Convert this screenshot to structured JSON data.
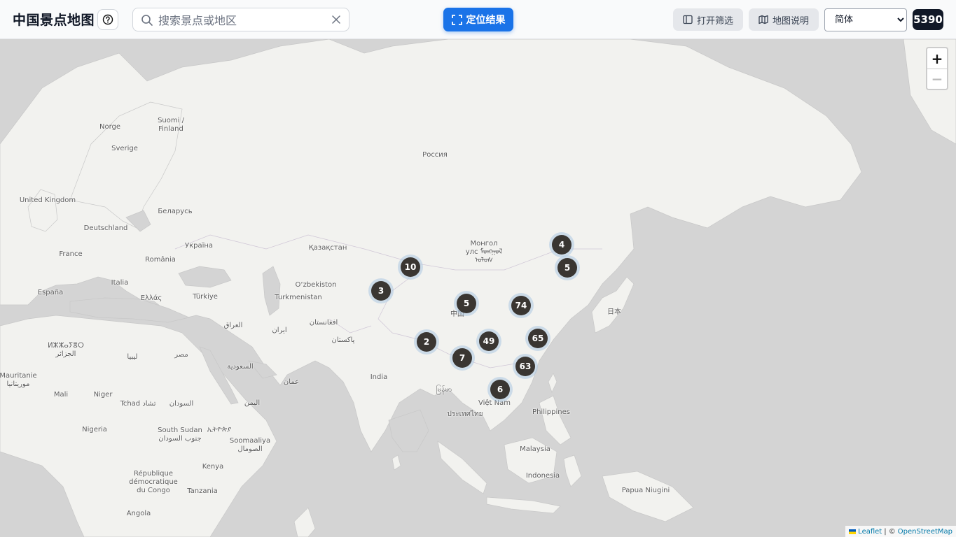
{
  "header": {
    "title": "中国景点地图",
    "search_placeholder": "搜索景点或地区",
    "locate_label": "定位结果",
    "filter_label": "打开筛选",
    "legend_label": "地图说明",
    "language": {
      "selected": "简体",
      "options": [
        "简体"
      ]
    },
    "count": "5390"
  },
  "map": {
    "zoom_in": "+",
    "zoom_out": "−",
    "attribution": {
      "leaflet": "Leaflet",
      "separator": "| ©",
      "osm": "OpenStreetMap"
    },
    "places": [
      {
        "id": "norge",
        "label": "Norge"
      },
      {
        "id": "suomi",
        "label": "Suomi /\nFinland"
      },
      {
        "id": "sverige",
        "label": "Sverige"
      },
      {
        "id": "russia",
        "label": "Россия"
      },
      {
        "id": "uk",
        "label": "United Kingdom"
      },
      {
        "id": "belarus",
        "label": "Беларусь"
      },
      {
        "id": "deutschland",
        "label": "Deutschland"
      },
      {
        "id": "ukraine",
        "label": "Україна"
      },
      {
        "id": "france",
        "label": "France"
      },
      {
        "id": "romania",
        "label": "România"
      },
      {
        "id": "kazakhstan",
        "label": "Қазақстан"
      },
      {
        "id": "mongolia",
        "label": "Монгол\nулс ᠮᠣᠩᠭᠣᠯ\nᠤᠯᠤᠰ"
      },
      {
        "id": "italia",
        "label": "Italia"
      },
      {
        "id": "espana",
        "label": "España"
      },
      {
        "id": "hellas",
        "label": "Ελλάς"
      },
      {
        "id": "turkiye",
        "label": "Türkiye"
      },
      {
        "id": "uzbekistan",
        "label": "O‘zbekiston"
      },
      {
        "id": "turkmenistan",
        "label": "Turkmenistan"
      },
      {
        "id": "japan",
        "label": "日本"
      },
      {
        "id": "china",
        "label": "中国"
      },
      {
        "id": "iraq",
        "label": "العراق"
      },
      {
        "id": "iran",
        "label": "ایران"
      },
      {
        "id": "afghanistan",
        "label": "افغانستان"
      },
      {
        "id": "pakistan",
        "label": "پاکستان"
      },
      {
        "id": "algeria",
        "label": "ⵍⵣⵣⴰⵢⴻⵔ\nالجزائر"
      },
      {
        "id": "libya",
        "label": "ليبيا"
      },
      {
        "id": "egypt",
        "label": "مصر"
      },
      {
        "id": "saudi",
        "label": "السعودية"
      },
      {
        "id": "india",
        "label": "India"
      },
      {
        "id": "oman",
        "label": "عمان"
      },
      {
        "id": "myanmar",
        "label": "မြန်မာ"
      },
      {
        "id": "vietnam",
        "label": "Việt Nam"
      },
      {
        "id": "mauritanie",
        "label": "Mauritanie\nموريتانيا"
      },
      {
        "id": "mali",
        "label": "Mali"
      },
      {
        "id": "niger",
        "label": "Niger"
      },
      {
        "id": "tchad",
        "label": "Tchad تشاد"
      },
      {
        "id": "sudan",
        "label": "السودان"
      },
      {
        "id": "yemen",
        "label": "اليمن"
      },
      {
        "id": "thailand",
        "label": "ประเทศไทย"
      },
      {
        "id": "philippines",
        "label": "Philippines"
      },
      {
        "id": "nigeria",
        "label": "Nigeria"
      },
      {
        "id": "southsudan",
        "label": "South Sudan\nجنوب السودان"
      },
      {
        "id": "ethiopia",
        "label": "ኢትዮጵያ"
      },
      {
        "id": "somalia",
        "label": "Soomaaliya\nالصومال"
      },
      {
        "id": "malaysia",
        "label": "Malaysia"
      },
      {
        "id": "kenya",
        "label": "Kenya"
      },
      {
        "id": "drc",
        "label": "République\ndémocratique\ndu Congo"
      },
      {
        "id": "indonesia",
        "label": "Indonesia"
      },
      {
        "id": "tanzania",
        "label": "Tanzania"
      },
      {
        "id": "png",
        "label": "Papua Niugini"
      },
      {
        "id": "angola",
        "label": "Angola"
      }
    ],
    "clusters": [
      {
        "id": "c1",
        "count": "4"
      },
      {
        "id": "c2",
        "count": "5"
      },
      {
        "id": "c3",
        "count": "10"
      },
      {
        "id": "c4",
        "count": "3"
      },
      {
        "id": "c5",
        "count": "5"
      },
      {
        "id": "c6",
        "count": "74"
      },
      {
        "id": "c7",
        "count": "2"
      },
      {
        "id": "c8",
        "count": "49"
      },
      {
        "id": "c9",
        "count": "65"
      },
      {
        "id": "c10",
        "count": "7"
      },
      {
        "id": "c11",
        "count": "63"
      },
      {
        "id": "c12",
        "count": "6"
      }
    ]
  }
}
